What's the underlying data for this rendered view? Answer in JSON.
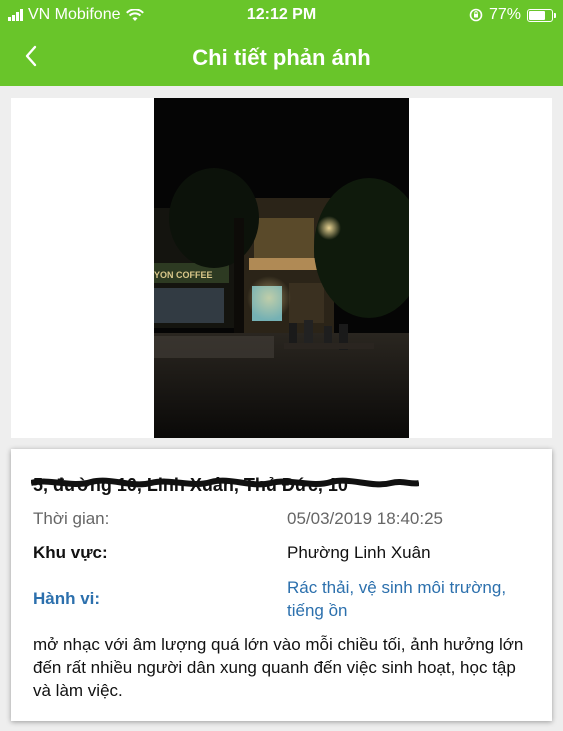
{
  "status_bar": {
    "carrier": "VN Mobifone",
    "time": "12:12 PM",
    "battery_percent": "77%",
    "battery_level": 0.77
  },
  "nav": {
    "back_icon": "chevron-left",
    "title": "Chi tiết phản ánh"
  },
  "report": {
    "address": "5, đường 10, Linh Xuân, Thủ Đức, 10",
    "time_label": "Thời gian:",
    "time_value": "05/03/2019 18:40:25",
    "area_label": "Khu vực:",
    "area_value": "Phường Linh Xuân",
    "behavior_label": "Hành vi:",
    "behavior_value": "Rác thải, vệ sinh môi trường, tiếng ồn",
    "description": "mở nhạc với âm lượng quá lớn vào mỗi chiều tối, ảnh hưởng lớn đến rất nhiều người dân xung quanh đến việc sinh hoạt, học tập và làm việc."
  },
  "photo": {
    "sign_text": "YON COFFEE"
  },
  "colors": {
    "header_green": "#69c52a",
    "label_gray": "#666666",
    "link_blue": "#2c70ad",
    "text_dark": "#111111"
  }
}
